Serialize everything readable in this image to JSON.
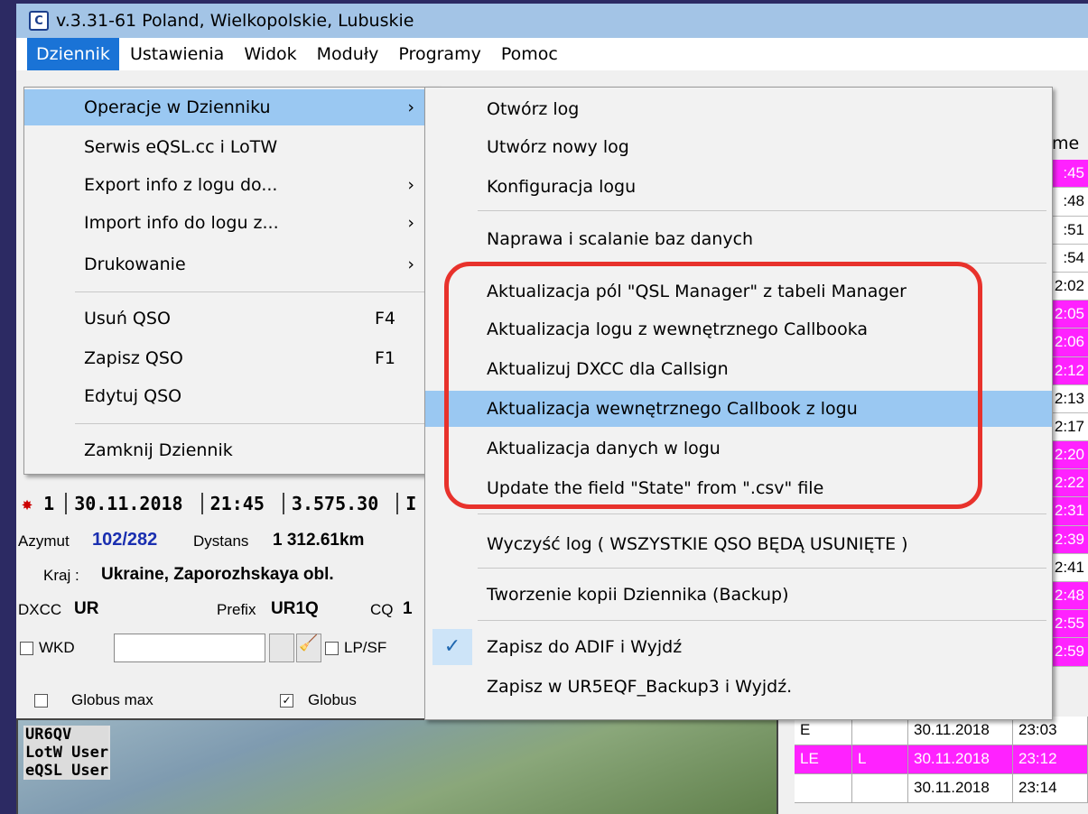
{
  "window": {
    "title": "v.3.31-61 Poland, Wielkopolskie, Lubuskie",
    "icon_label": "C"
  },
  "menubar": [
    "Dziennik",
    "Ustawienia",
    "Widok",
    "Moduły",
    "Programy",
    "Pomoc"
  ],
  "menu_dziennik": {
    "operacje": "Operacje w Dzienniku",
    "serwis": "Serwis eQSL.cc i LoTW",
    "export": "Export info z logu do...",
    "import": "Import  info do logu z...",
    "druk": "Drukowanie",
    "usun": "Usuń QSO",
    "usun_sc": "F4",
    "zapisz": "Zapisz QSO",
    "zapisz_sc": "F1",
    "edytuj": "Edytuj QSO",
    "zamknij": "Zamknij Dziennik",
    "arrow": "›"
  },
  "submenu": {
    "otworz": "Otwórz log",
    "utworz": "Utwórz nowy log",
    "konfig": "Konfiguracja logu",
    "naprawa": "Naprawa i scalanie baz danych",
    "qslmgr": "Aktualizacja pól \"QSL Manager\" z tabeli Manager",
    "callbook_log": "Aktualizacja logu z wewnętrznego Callbooka",
    "dxcc": "Aktualizuj DXCC dla Callsign",
    "callbook_from_log": "Aktualizacja wewnętrznego Callbook z logu",
    "dane": "Aktualizacja danych w logu",
    "state": "Update the field \"State\" from \".csv\" file",
    "wyczysc": "Wyczyść log ( WSZYSTKIE QSO BĘDĄ USUNIĘTE )",
    "backup": "Tworzenie kopii Dziennika (Backup)",
    "zapisz_adif": "Zapisz do ADIF i Wyjdź",
    "zapisz_backup": "Zapisz w UR5EQF_Backup3 i Wyjdź.",
    "check": "✓"
  },
  "right_column": {
    "header": "me",
    "times": [
      ":45",
      ":48",
      ":51",
      ":54",
      "2:02",
      "2:05",
      "2:06",
      "2:12",
      "2:13",
      "2:17",
      "2:20",
      "2:22",
      "2:31",
      "2:39",
      "2:41",
      "2:48",
      "2:55",
      "2:59"
    ]
  },
  "qso_line": {
    "num": "1",
    "date": "30.11.2018",
    "time": "21:45",
    "freq": "3.575.30",
    "trail": "I"
  },
  "info": {
    "azimuth_label": "Azymut",
    "azimuth": "102/282",
    "distance_label": "Dystans",
    "distance": "1 312.61km",
    "country_label": "Kraj :",
    "country": "Ukraine, Zaporozhskaya obl.",
    "dxcc_label": "DXCC",
    "dxcc": "UR",
    "prefix_label": "Prefix",
    "prefix": "UR1Q",
    "cq_label": "CQ",
    "cq": "1",
    "wkd": "WKD",
    "lpsp": "LP/SF",
    "globus_max": "Globus max",
    "globus": "Globus",
    "globus_checked": "✓"
  },
  "globe": {
    "call": "UR6QV",
    "lotw": "LotW User",
    "eqsl": "eQSL User"
  },
  "bottom_table": [
    {
      "a": "E",
      "b": "",
      "date": "30.11.2018",
      "time": "23:03"
    },
    {
      "a": "LE",
      "b": "L",
      "date": "30.11.2018",
      "time": "23:12"
    },
    {
      "a": "",
      "b": "",
      "date": "30.11.2018",
      "time": "23:14"
    }
  ]
}
